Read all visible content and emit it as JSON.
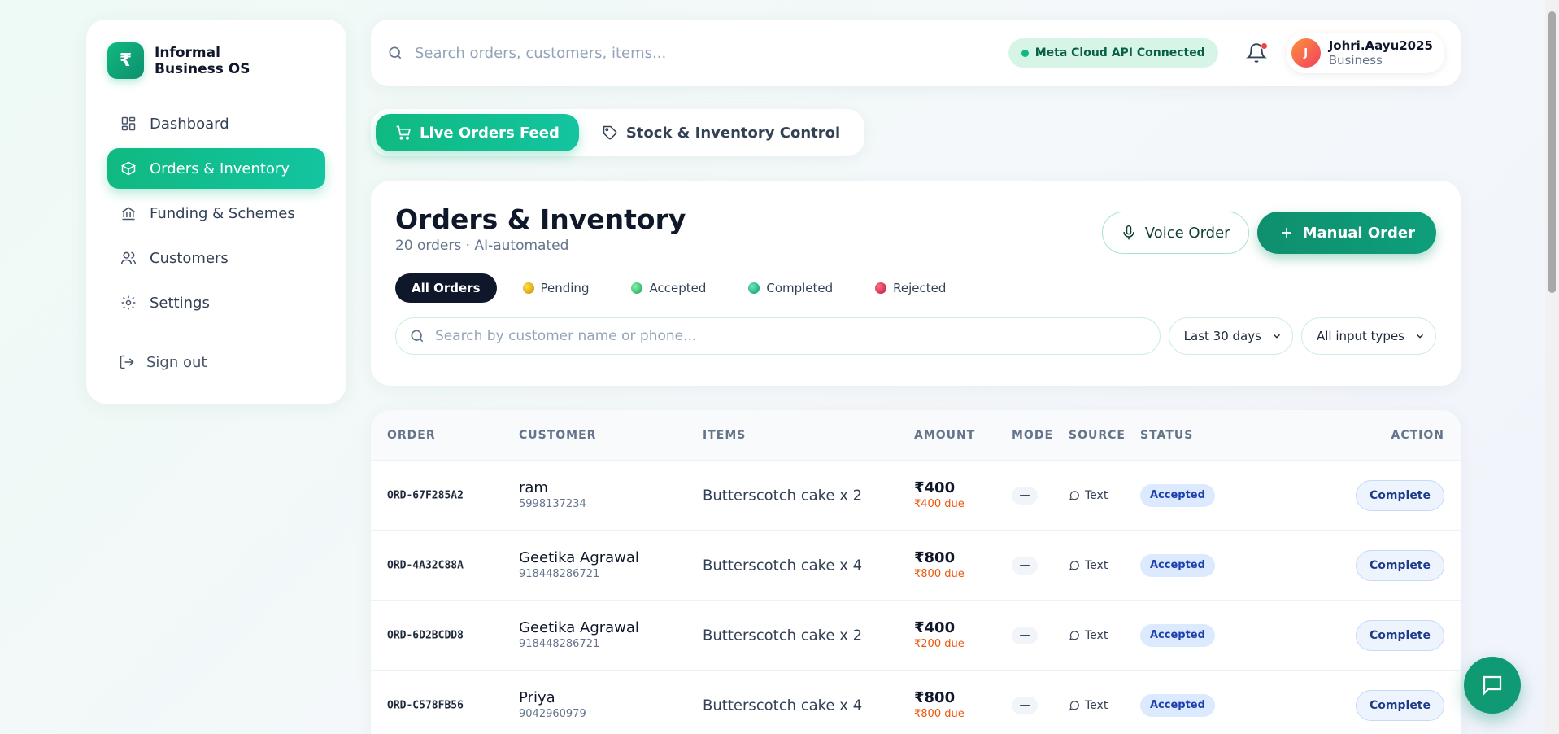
{
  "brand": {
    "symbol": "₹",
    "line1": "Informal",
    "line2": "Business OS"
  },
  "sidebar": {
    "items": [
      {
        "label": "Dashboard",
        "icon": "dashboard-icon"
      },
      {
        "label": "Orders & Inventory",
        "icon": "box-icon"
      },
      {
        "label": "Funding & Schemes",
        "icon": "bank-icon"
      },
      {
        "label": "Customers",
        "icon": "users-icon"
      },
      {
        "label": "Settings",
        "icon": "gear-icon"
      }
    ],
    "active": "Orders & Inventory",
    "signout": "Sign out"
  },
  "topbar": {
    "search_placeholder": "Search orders, customers, items...",
    "api_status": "Meta Cloud API Connected",
    "user": {
      "initial": "J",
      "name": "Johri.Aayu2025",
      "role": "Business"
    }
  },
  "tabs": [
    {
      "label": "Live Orders Feed",
      "icon": "cart-icon"
    },
    {
      "label": "Stock & Inventory Control",
      "icon": "tag-icon"
    }
  ],
  "header": {
    "title": "Orders & Inventory",
    "subtitle": "20 orders · AI-automated",
    "voice_label": "Voice Order",
    "manual_label": "Manual Order"
  },
  "filters": [
    {
      "label": "All Orders",
      "color": ""
    },
    {
      "label": "Pending",
      "color": "#eab308"
    },
    {
      "label": "Accepted",
      "color": "#22c55e"
    },
    {
      "label": "Completed",
      "color": "#10b981"
    },
    {
      "label": "Rejected",
      "color": "#e11d48"
    }
  ],
  "search": {
    "placeholder": "Search by customer name or phone...",
    "date_range": "Last 30 days",
    "input_type": "All input types"
  },
  "table": {
    "columns": [
      "ORDER",
      "CUSTOMER",
      "ITEMS",
      "AMOUNT",
      "MODE",
      "SOURCE",
      "STATUS",
      "ACTION"
    ],
    "rows": [
      {
        "order": "ORD-67F285A2",
        "name": "ram",
        "phone": "5998137234",
        "items": "Butterscotch cake x 2",
        "amount": "₹400",
        "due": "₹400 due",
        "mode": "—",
        "source": "Text",
        "status": "Accepted",
        "action": "Complete"
      },
      {
        "order": "ORD-4A32C88A",
        "name": "Geetika Agrawal",
        "phone": "918448286721",
        "items": "Butterscotch cake x 4",
        "amount": "₹800",
        "due": "₹800 due",
        "mode": "—",
        "source": "Text",
        "status": "Accepted",
        "action": "Complete"
      },
      {
        "order": "ORD-6D2BCDD8",
        "name": "Geetika Agrawal",
        "phone": "918448286721",
        "items": "Butterscotch cake x 2",
        "amount": "₹400",
        "due": "₹200 due",
        "mode": "—",
        "source": "Text",
        "status": "Accepted",
        "action": "Complete"
      },
      {
        "order": "ORD-C578FB56",
        "name": "Priya",
        "phone": "9042960979",
        "items": "Butterscotch cake x 4",
        "amount": "₹800",
        "due": "₹800 due",
        "mode": "—",
        "source": "Text",
        "status": "Accepted",
        "action": "Complete"
      }
    ]
  },
  "colors": {
    "accent": "#10b981",
    "accent_dark": "#0f8f6e",
    "badge_bg": "#dbeafe",
    "due": "#ea580c"
  }
}
